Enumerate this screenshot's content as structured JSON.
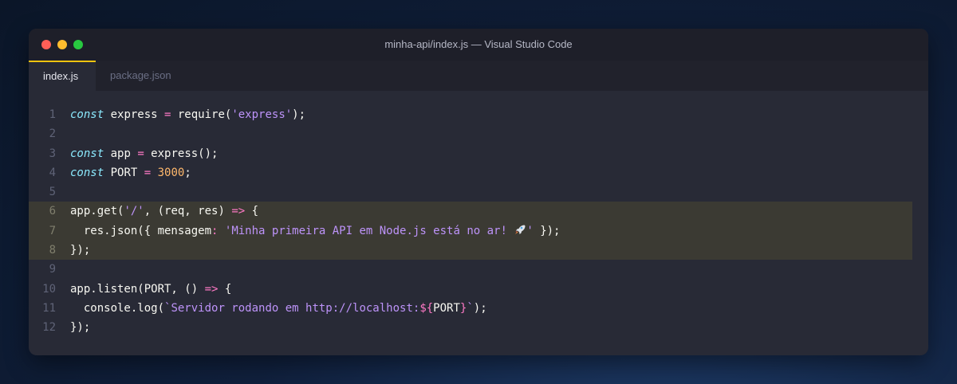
{
  "window": {
    "title": "minha-api/index.js — Visual Studio Code"
  },
  "tabs": [
    {
      "label": "index.js",
      "active": true
    },
    {
      "label": "package.json",
      "active": false
    }
  ],
  "colors": {
    "background": "#282a36",
    "highlight": "#3b3a33",
    "active_tab_accent": "#f1c40f"
  },
  "code_lines": [
    {
      "n": "1",
      "text": "const express = require('express');"
    },
    {
      "n": "2",
      "text": ""
    },
    {
      "n": "3",
      "text": "const app = express();"
    },
    {
      "n": "4",
      "text": "const PORT = 3000;"
    },
    {
      "n": "5",
      "text": ""
    },
    {
      "n": "6",
      "text": "app.get('/', (req, res) => {",
      "highlighted": true
    },
    {
      "n": "7",
      "text": "  res.json({ mensagem: 'Minha primeira API em Node.js está no ar! 🚀' });",
      "highlighted": true
    },
    {
      "n": "8",
      "text": "});",
      "highlighted": true
    },
    {
      "n": "9",
      "text": ""
    },
    {
      "n": "10",
      "text": "app.listen(PORT, () => {"
    },
    {
      "n": "11",
      "text": "  console.log(`Servidor rodando em http://localhost:${PORT}`);"
    },
    {
      "n": "12",
      "text": "});"
    }
  ],
  "tokens": {
    "l1": {
      "kw": "const",
      "a": " express ",
      "op": "=",
      "b": " require(",
      "str": "'express'",
      "c": ");"
    },
    "l3": {
      "kw": "const",
      "a": " app ",
      "op": "=",
      "b": " express();"
    },
    "l4": {
      "kw": "const",
      "a": " PORT ",
      "op": "=",
      "b": " ",
      "num": "3000",
      "c": ";"
    },
    "l6": {
      "a": "app.get(",
      "str": "'/'",
      "b": ", (req, res) ",
      "op": "=>",
      "c": " {"
    },
    "l7": {
      "a": "  res.json({ mensagem",
      "op": ":",
      "b": " ",
      "str1": "'Minha primeira API em Node.js está no ar! ",
      "str2": "'",
      "c": " });"
    },
    "l8": {
      "a": "});"
    },
    "l10": {
      "a": "app.listen(PORT, () ",
      "op": "=>",
      "c": " {"
    },
    "l11": {
      "a": "  console.log(",
      "t1": "`Servidor rodando em http://localhost:",
      "i1": "${",
      "mid": "PORT",
      "i2": "}",
      "t2": "`",
      "c": ");"
    },
    "l12": {
      "a": "});"
    }
  }
}
